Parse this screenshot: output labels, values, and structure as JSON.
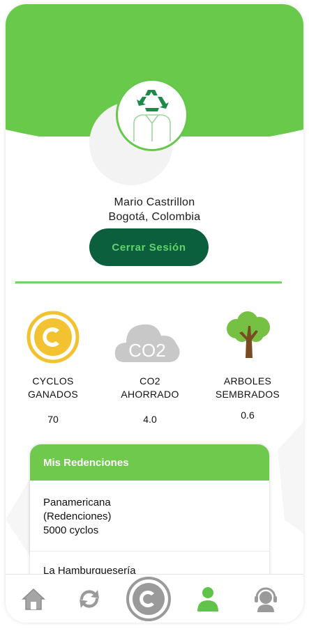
{
  "profile": {
    "name": "Mario Castrillon",
    "city": "Bogotá, Colombia",
    "logout_label": "Cerrar Sesión",
    "avatar_icon": "recycle-person-icon"
  },
  "stats": [
    {
      "label_line1": "CYCLOS",
      "label_line2": "GANADOS",
      "value": "70",
      "icon": "cyclos-coin-icon"
    },
    {
      "label_line1": "CO2",
      "label_line2": "AHORRADO",
      "value": "4.0",
      "icon": "co2-cloud-icon",
      "icon_text": "CO2"
    },
    {
      "label_line1": "ARBOLES",
      "label_line2": "SEMBRADOS",
      "value": "0.6",
      "icon": "tree-icon"
    }
  ],
  "redemptions": {
    "title": "Mis Redenciones",
    "items": [
      {
        "line1": "Panamericana",
        "line2": "(Redenciones)",
        "line3": "5000 cyclos"
      },
      {
        "line1": "La Hamburquesería"
      }
    ]
  },
  "nav": [
    {
      "icon": "home-icon"
    },
    {
      "icon": "recycle-arrows-icon"
    },
    {
      "icon": "cyclos-coin-icon"
    },
    {
      "icon": "profile-icon",
      "active": true
    },
    {
      "icon": "support-headset-icon"
    }
  ],
  "colors": {
    "header_green": "#68c94a",
    "button_dark_green": "#0c5f3c",
    "button_text_green": "#63d26a",
    "card_header_green": "#6fc94c",
    "coin_yellow": "#f2c230",
    "cloud_gray": "#c8c8c8",
    "tree_green": "#76c043",
    "nav_gray": "#9a9a9a"
  }
}
